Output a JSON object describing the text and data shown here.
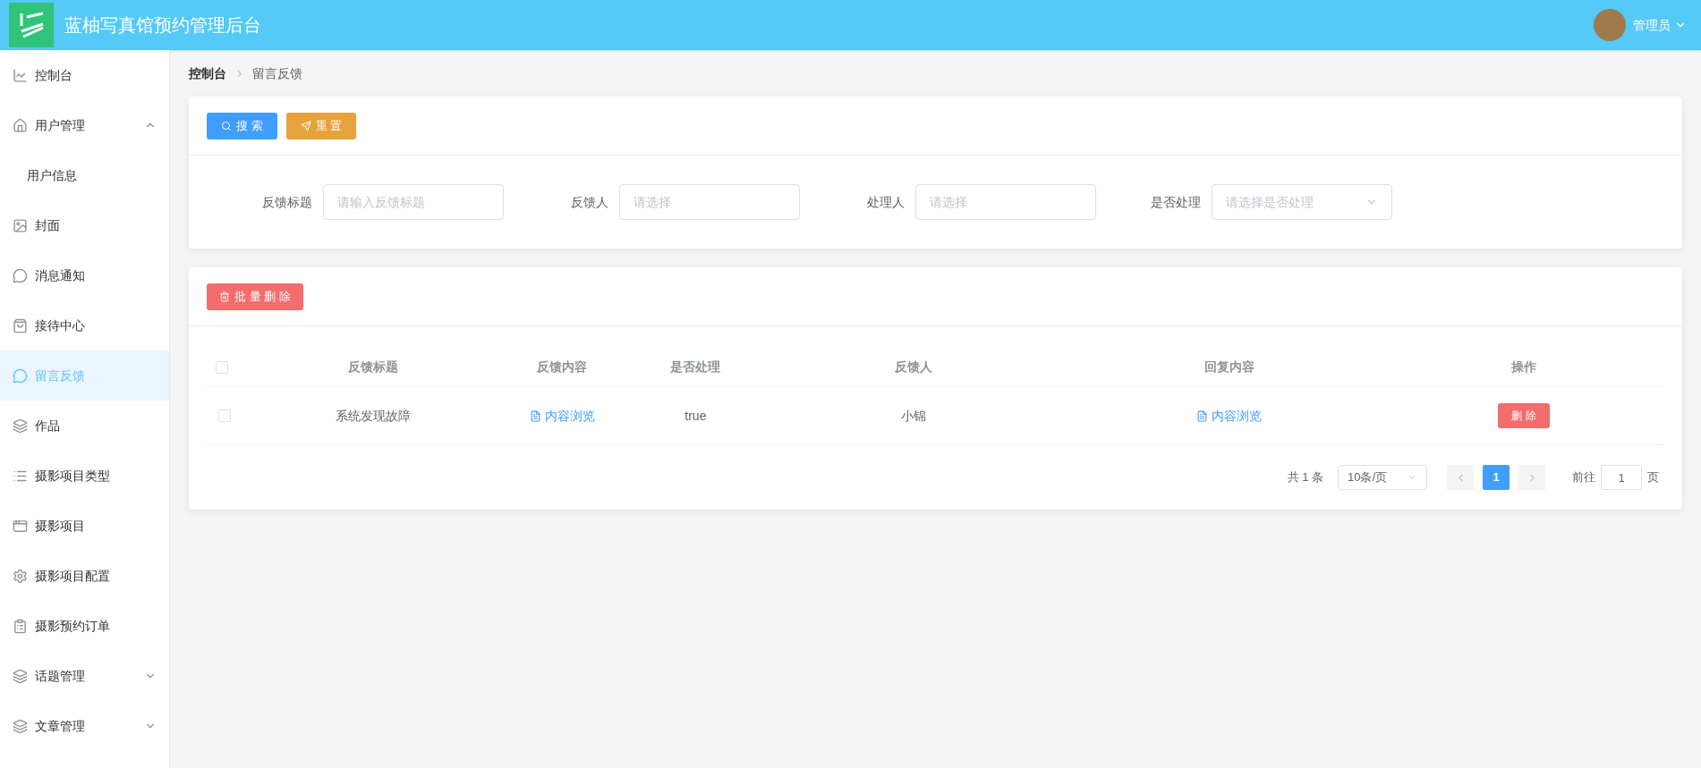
{
  "header": {
    "title": "蓝柚写真馆预约管理后台",
    "user": "管理员"
  },
  "sidebar": {
    "items": [
      {
        "label": "控制台",
        "selected": false
      },
      {
        "label": "用户管理",
        "selected": false,
        "expanded": true,
        "children": [
          {
            "label": "用户信息",
            "selected": false
          }
        ]
      },
      {
        "label": "封面",
        "selected": false
      },
      {
        "label": "消息通知",
        "selected": false
      },
      {
        "label": "接待中心",
        "selected": false
      },
      {
        "label": "留言反馈",
        "selected": true
      },
      {
        "label": "作品",
        "selected": false
      },
      {
        "label": "摄影项目类型",
        "selected": false
      },
      {
        "label": "摄影项目",
        "selected": false
      },
      {
        "label": "摄影项目配置",
        "selected": false
      },
      {
        "label": "摄影预约订单",
        "selected": false
      },
      {
        "label": "话题管理",
        "selected": false,
        "expanded": false
      },
      {
        "label": "文章管理",
        "selected": false,
        "expanded": false
      }
    ]
  },
  "breadcrumb": [
    "控制台",
    "留言反馈"
  ],
  "search_panel": {
    "buttons": [
      {
        "label": "搜 索",
        "kind": "search"
      },
      {
        "label": "重 置",
        "kind": "reset"
      }
    ],
    "fields": [
      {
        "label": "反馈标题",
        "placeholder": "请输入反馈标题",
        "kind": "input"
      },
      {
        "label": "反馈人",
        "placeholder": "请选择",
        "kind": "input"
      },
      {
        "label": "处理人",
        "placeholder": "请选择",
        "kind": "input"
      },
      {
        "label": "是否处理",
        "placeholder": "请选择是否处理",
        "kind": "select"
      }
    ]
  },
  "table": {
    "batch_delete": "批 量 删 除",
    "select_all_checked": false,
    "columns": [
      "反馈标题",
      "反馈内容",
      "是否处理",
      "反馈人",
      "回复内容",
      "操作"
    ],
    "rows": [
      {
        "checked": false,
        "title": "系统发现故障",
        "content": "内容浏览",
        "handled": "true",
        "user": "小锦",
        "reply": "内容浏览",
        "action": "删 除"
      }
    ]
  },
  "pagination": {
    "total": "共 1 条",
    "page_size": "10条/页",
    "pages": [
      {
        "label": "1",
        "selected": true
      }
    ],
    "goto_label": "前往",
    "goto_value": "1",
    "page_suffix": "页"
  }
}
